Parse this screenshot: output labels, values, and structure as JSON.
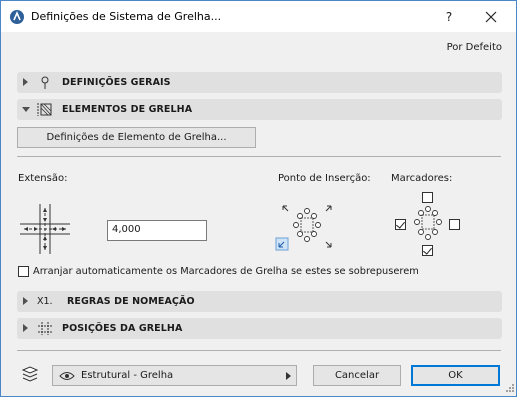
{
  "window": {
    "title": "Definições de Sistema de Grelha...",
    "help_label": "?"
  },
  "header": {
    "defaults_label": "Por Defeito"
  },
  "sections": {
    "general": {
      "label": "DEFINIÇÕES GERAIS",
      "expanded": false
    },
    "elements": {
      "label": "ELEMENTOS DE GRELHA",
      "expanded": true
    },
    "naming": {
      "label": "REGRAS DE NOMEAÇÃO",
      "prefix": "X1.",
      "expanded": false
    },
    "positions": {
      "label": "POSIÇÕES DA GRELHA",
      "expanded": false
    }
  },
  "elements": {
    "settings_button": "Definições de Elemento de Grelha...",
    "extension_label": "Extensão:",
    "extension_value": "4,000",
    "insertion_label": "Ponto de Inserção:",
    "markers_label": "Marcadores:",
    "markers": {
      "top": false,
      "left": true,
      "right": false,
      "bottom": true
    },
    "auto_arrange_label": "Arranjar automaticamente os Marcadores de Grelha se estes se sobrepuserem",
    "auto_arrange_checked": false
  },
  "footer": {
    "layer_value": "Estrutural - Grelha",
    "cancel_label": "Cancelar",
    "ok_label": "OK"
  },
  "colors": {
    "accent": "#0078d7",
    "section_bg": "#e0e0e0",
    "insertion_selected": "#cfe3f7"
  }
}
